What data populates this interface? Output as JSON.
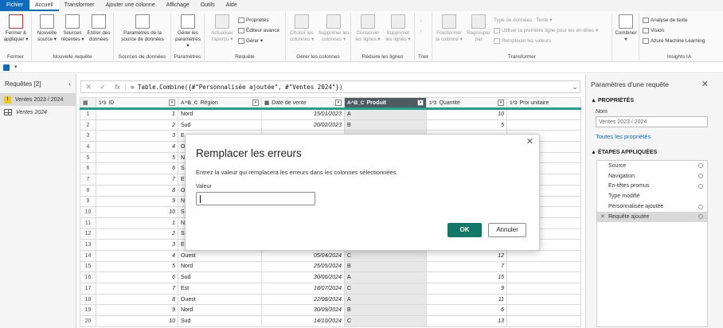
{
  "tabs": {
    "file": "Fichier",
    "home": "Accueil",
    "transform": "Transformer",
    "addcol": "Ajouter une colonne",
    "view": "Affichage",
    "tools": "Outils",
    "help": "Aide"
  },
  "ribbon": {
    "close_group": "Fermer",
    "close_apply": "Fermer &",
    "close_apply2": "appliquer ▾",
    "newq_group": "Nouvelle requête",
    "new_source": "Nouvelle",
    "new_source2": "source ▾",
    "recent": "Sources",
    "recent2": "récentes ▾",
    "enter": "Entrer des",
    "enter2": "données",
    "ds_group": "Sources de données",
    "ds_settings": "Paramètres de la",
    "ds_settings2": "source de données",
    "params_group": "Paramètres",
    "manage_params": "Gérer les",
    "manage_params2": "paramètres ▾",
    "query_group": "Requête",
    "refresh": "Actualiser",
    "refresh2": "l'aperçu ▾",
    "properties": "Propriétés",
    "adv_editor": "Éditeur avancé",
    "manage": "Gérer ▾",
    "cols_group": "Gérer les colonnes",
    "choose": "Choisir les",
    "choose2": "colonnes ▾",
    "remove": "Supprimer les",
    "remove2": "colonnes ▾",
    "rows_group": "Réduire les lignes",
    "keep": "Conserver",
    "keep2": "les lignes ▾",
    "remove_rows": "Supprimer",
    "remove_rows2": "les lignes ▾",
    "sort_group": "Trier",
    "transform_group": "Transformer",
    "split": "Fractionner",
    "split2": "la colonne ▾",
    "group": "Regrouper",
    "group2": "par",
    "dtype": "Type de données : Texte ▾",
    "first_row": "Utiliser la première ligne pour les en-têtes ▾",
    "replace": "Remplacer les valeurs",
    "combine": "Combiner",
    "combine2": "▾",
    "ai_group": "Insights IA",
    "text_analytics": "Analyse de texte",
    "vision": "Vision",
    "azure_ml": "Azure Machine Learning"
  },
  "queries": {
    "title": "Requêtes [2]",
    "items": [
      {
        "name": "Ventes 2023 / 2024"
      },
      {
        "name": "Ventes 2024"
      }
    ]
  },
  "formula": {
    "text": "= Table.Combine({#\"Personnalisée ajoutée\", #\"Ventes 2024\"})"
  },
  "table": {
    "headers": [
      {
        "type": "1²3",
        "name": "ID"
      },
      {
        "type": "A^B_C",
        "name": "Région"
      },
      {
        "type": "▦",
        "name": "Date de vente"
      },
      {
        "type": "A^B_C",
        "name": "Produit"
      },
      {
        "type": "1²3",
        "name": "Quantité"
      },
      {
        "type": "1²3",
        "name": "Prix unitaire"
      }
    ],
    "rows": [
      {
        "n": "1",
        "id": "1",
        "region": "Nord",
        "date": "15/01/2023",
        "produit": "A",
        "qte": "10"
      },
      {
        "n": "2",
        "id": "2",
        "region": "Sud",
        "date": "20/02/2023",
        "produit": "B",
        "qte": "5"
      },
      {
        "n": "3",
        "id": "3",
        "region": "E",
        "date": "",
        "produit": "",
        "qte": ""
      },
      {
        "n": "4",
        "id": "4",
        "region": "O",
        "date": "",
        "produit": "",
        "qte": ""
      },
      {
        "n": "5",
        "id": "5",
        "region": "N",
        "date": "",
        "produit": "",
        "qte": ""
      },
      {
        "n": "6",
        "id": "6",
        "region": "S",
        "date": "",
        "produit": "",
        "qte": ""
      },
      {
        "n": "7",
        "id": "7",
        "region": "E",
        "date": "",
        "produit": "",
        "qte": ""
      },
      {
        "n": "8",
        "id": "8",
        "region": "O",
        "date": "",
        "produit": "",
        "qte": ""
      },
      {
        "n": "9",
        "id": "9",
        "region": "N",
        "date": "",
        "produit": "",
        "qte": ""
      },
      {
        "n": "10",
        "id": "10",
        "region": "S",
        "date": "",
        "produit": "",
        "qte": ""
      },
      {
        "n": "11",
        "id": "1",
        "region": "N",
        "date": "",
        "produit": "",
        "qte": ""
      },
      {
        "n": "12",
        "id": "2",
        "region": "S",
        "date": "",
        "produit": "",
        "qte": ""
      },
      {
        "n": "13",
        "id": "3",
        "region": "E",
        "date": "",
        "produit": "",
        "qte": ""
      },
      {
        "n": "14",
        "id": "4",
        "region": "Ouest",
        "date": "05/04/2024",
        "produit": "C",
        "qte": "12"
      },
      {
        "n": "15",
        "id": "5",
        "region": "Nord",
        "date": "25/05/2024",
        "produit": "B",
        "qte": "7"
      },
      {
        "n": "16",
        "id": "6",
        "region": "Sud",
        "date": "30/06/2024",
        "produit": "A",
        "qte": "15"
      },
      {
        "n": "17",
        "id": "7",
        "region": "Est",
        "date": "18/07/2024",
        "produit": "C",
        "qte": "9"
      },
      {
        "n": "18",
        "id": "8",
        "region": "Ouest",
        "date": "22/08/2024",
        "produit": "A",
        "qte": "11"
      },
      {
        "n": "19",
        "id": "9",
        "region": "Nord",
        "date": "30/09/2024",
        "produit": "B",
        "qte": "6"
      },
      {
        "n": "20",
        "id": "10",
        "region": "Sud",
        "date": "14/10/2024",
        "produit": "C",
        "qte": "13"
      }
    ]
  },
  "settings": {
    "title": "Paramètres d'une requête",
    "props_section": "▲ PROPRIÉTÉS",
    "name_label": "Nom",
    "name_value": "Ventes 2023 / 2024",
    "all_props": "Toutes les propriétés",
    "steps_section": "▲ ÉTAPES APPLIQUÉES",
    "steps": [
      {
        "name": "Source"
      },
      {
        "name": "Navigation"
      },
      {
        "name": "En-têtes promus"
      },
      {
        "name": "Type modifié"
      },
      {
        "name": "Personnalisée ajoutée"
      },
      {
        "name": "Requête ajoutée"
      }
    ]
  },
  "dialog": {
    "title": "Remplacer les erreurs",
    "description": "Entrez la valeur qui remplacera les erreurs dans les colonnes sélectionnées.",
    "label": "Valeur",
    "value": "",
    "ok": "OK",
    "cancel": "Annuler"
  },
  "colors": {
    "accent": "#0f6cbd",
    "ok_button": "#117865",
    "header_underline": "#21a08a"
  }
}
